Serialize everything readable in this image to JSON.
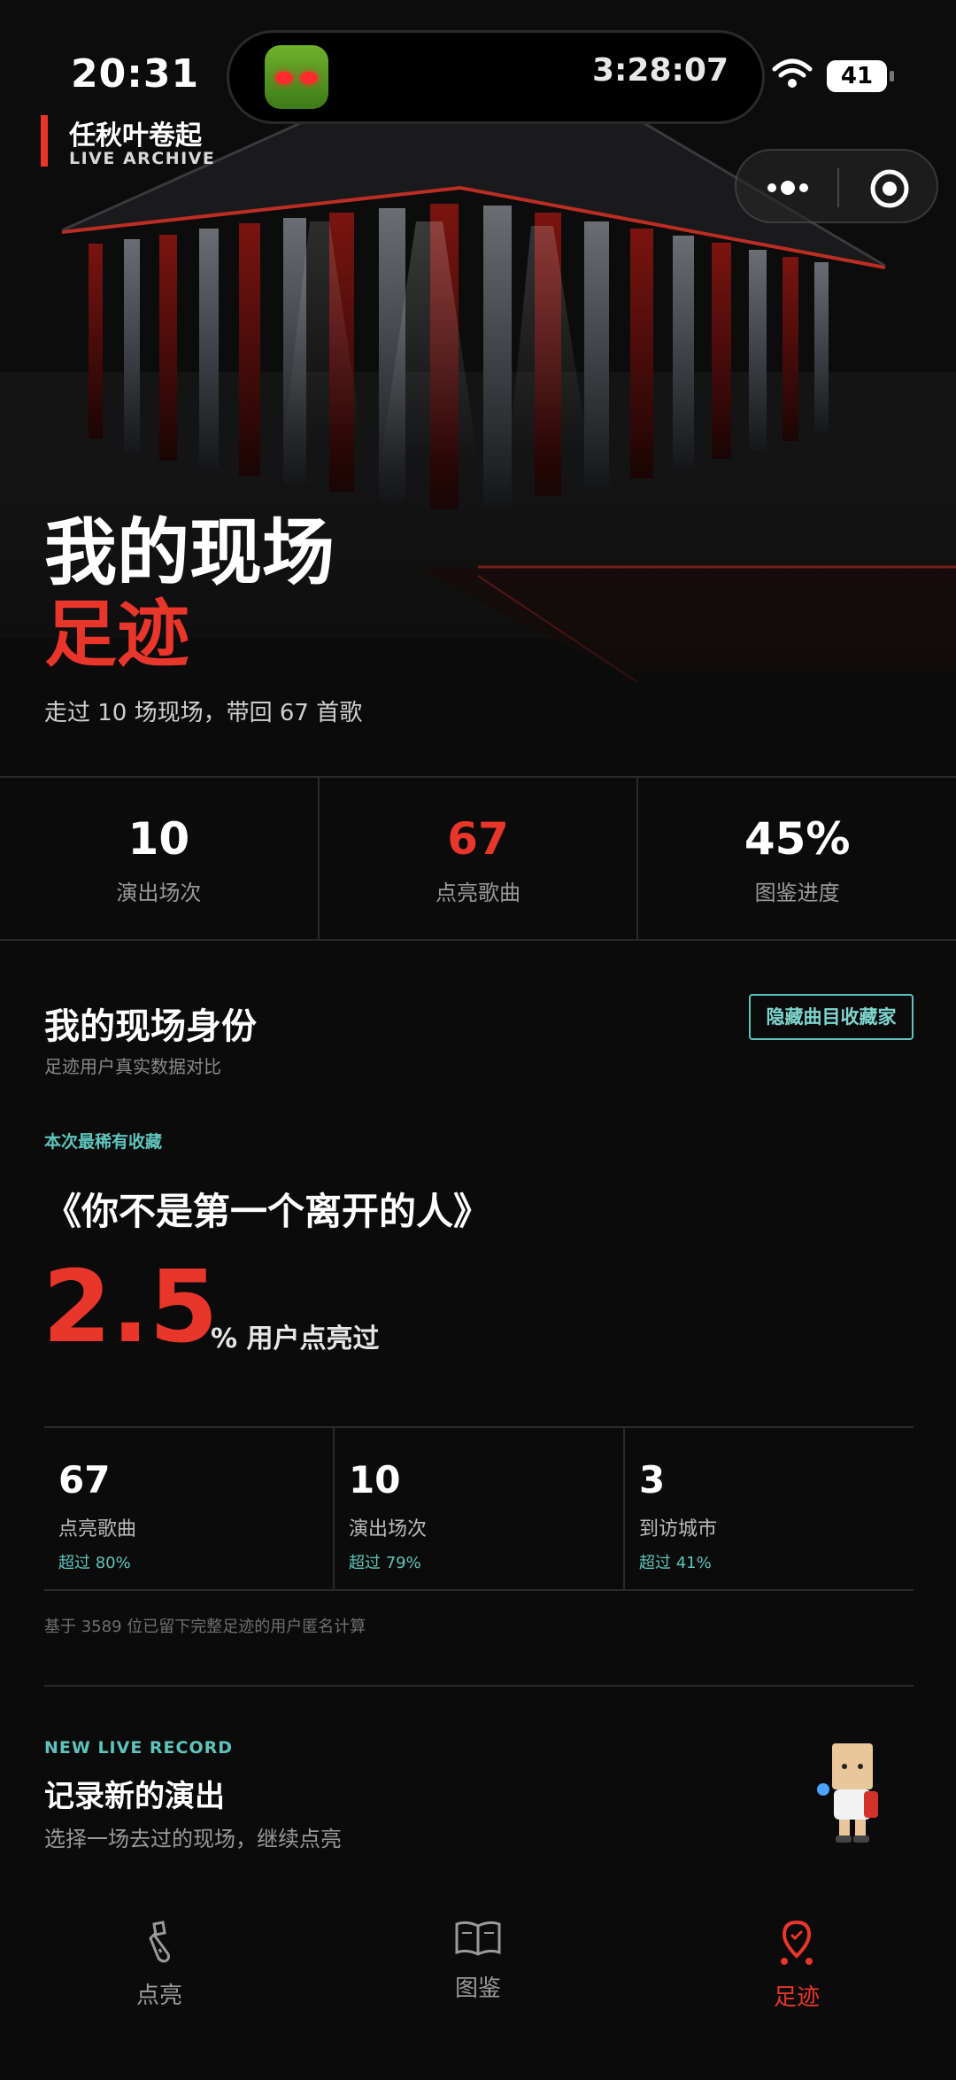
{
  "status_bar": {
    "time": "20:31",
    "timer": "3:28:07",
    "battery": "41"
  },
  "brand": {
    "title": "任秋叶卷起",
    "subtitle": "LIVE ARCHIVE"
  },
  "hero": {
    "title_line1": "我的现场",
    "title_line2": "足迹",
    "subtitle": "走过 10 场现场，带回 67 首歌"
  },
  "stats": [
    {
      "value": "10",
      "label": "演出场次"
    },
    {
      "value": "67",
      "label": "点亮歌曲"
    },
    {
      "value": "45%",
      "label": "图鉴进度"
    }
  ],
  "identity": {
    "title": "我的现场身份",
    "subtitle": "足迹用户真实数据对比",
    "badge": "隐藏曲目收藏家",
    "rare_label": "本次最稀有收藏",
    "rare_song": "《你不是第一个离开的人》",
    "rare_percent": "2.5",
    "rare_percent_text": "% 用户点亮过",
    "metrics": [
      {
        "value": "67",
        "label": "点亮歌曲",
        "over": "超过 80%"
      },
      {
        "value": "10",
        "label": "演出场次",
        "over": "超过 79%"
      },
      {
        "value": "3",
        "label": "到访城市",
        "over": "超过 41%"
      }
    ],
    "footnote": "基于 3589 位已留下完整足迹的用户匿名计算"
  },
  "new_record": {
    "label": "NEW LIVE RECORD",
    "title": "记录新的演出",
    "subtitle": "选择一场去过的现场，继续点亮"
  },
  "tabbar": {
    "items": [
      {
        "label": "点亮",
        "icon": "light-stick-icon",
        "active": false
      },
      {
        "label": "图鉴",
        "icon": "book-icon",
        "active": false
      },
      {
        "label": "足迹",
        "icon": "location-pin-icon",
        "active": true
      }
    ]
  },
  "colors": {
    "accent_red": "#e8362b",
    "accent_teal": "#5fc4bd",
    "background": "#0b0b0b"
  }
}
